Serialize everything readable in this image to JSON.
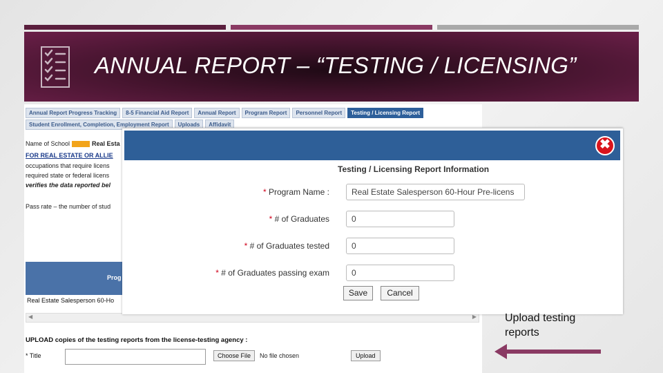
{
  "slide": {
    "title": "ANNUAL REPORT – “TESTING / LICENSING”",
    "callout": [
      "Upload testing",
      "reports"
    ],
    "icon": "checklist-icon",
    "colors": {
      "banner": "#3e1229",
      "accent": "#8a3a63",
      "arrow": "#8a3a63"
    }
  },
  "tabs": {
    "row1": [
      "Annual Report Progress Tracking",
      "8-5 Financial Aid Report",
      "Annual Report",
      "Program Report",
      "Personnel Report",
      "Testing / Licensing Report"
    ],
    "row2": [
      "Student Enrollment, Completion, Employment Report",
      "Uploads",
      "Affidavit"
    ],
    "active": "Testing / Licensing Report"
  },
  "background": {
    "school_label": "Name of School",
    "school_value": "Real Esta",
    "lines": [
      "FOR REAL ESTATE OR ALLIE",
      "occupations that require licens",
      "required state or federal licens",
      "verifies the data reported bel"
    ],
    "pass_rate": "Pass rate – the number of stud",
    "table_header": "Prog",
    "table_row": "Real Estate Salesperson 60-Ho"
  },
  "upload": {
    "heading": "UPLOAD copies of the testing reports from the license-testing agency :",
    "title_label": "* Title",
    "choose_file": "Choose File",
    "no_file": "No file chosen",
    "upload_button": "Upload"
  },
  "modal": {
    "title": "Testing / Licensing Report Information",
    "fields": [
      {
        "label": "Program Name :",
        "value": "Real Estate Salesperson 60-Hour Pre-licens"
      },
      {
        "label": "# of Graduates",
        "value": "0"
      },
      {
        "label": "# of Graduates tested",
        "value": "0"
      },
      {
        "label": "# of Graduates passing exam",
        "value": "0"
      }
    ],
    "save": "Save",
    "cancel": "Cancel",
    "close": "✖"
  }
}
